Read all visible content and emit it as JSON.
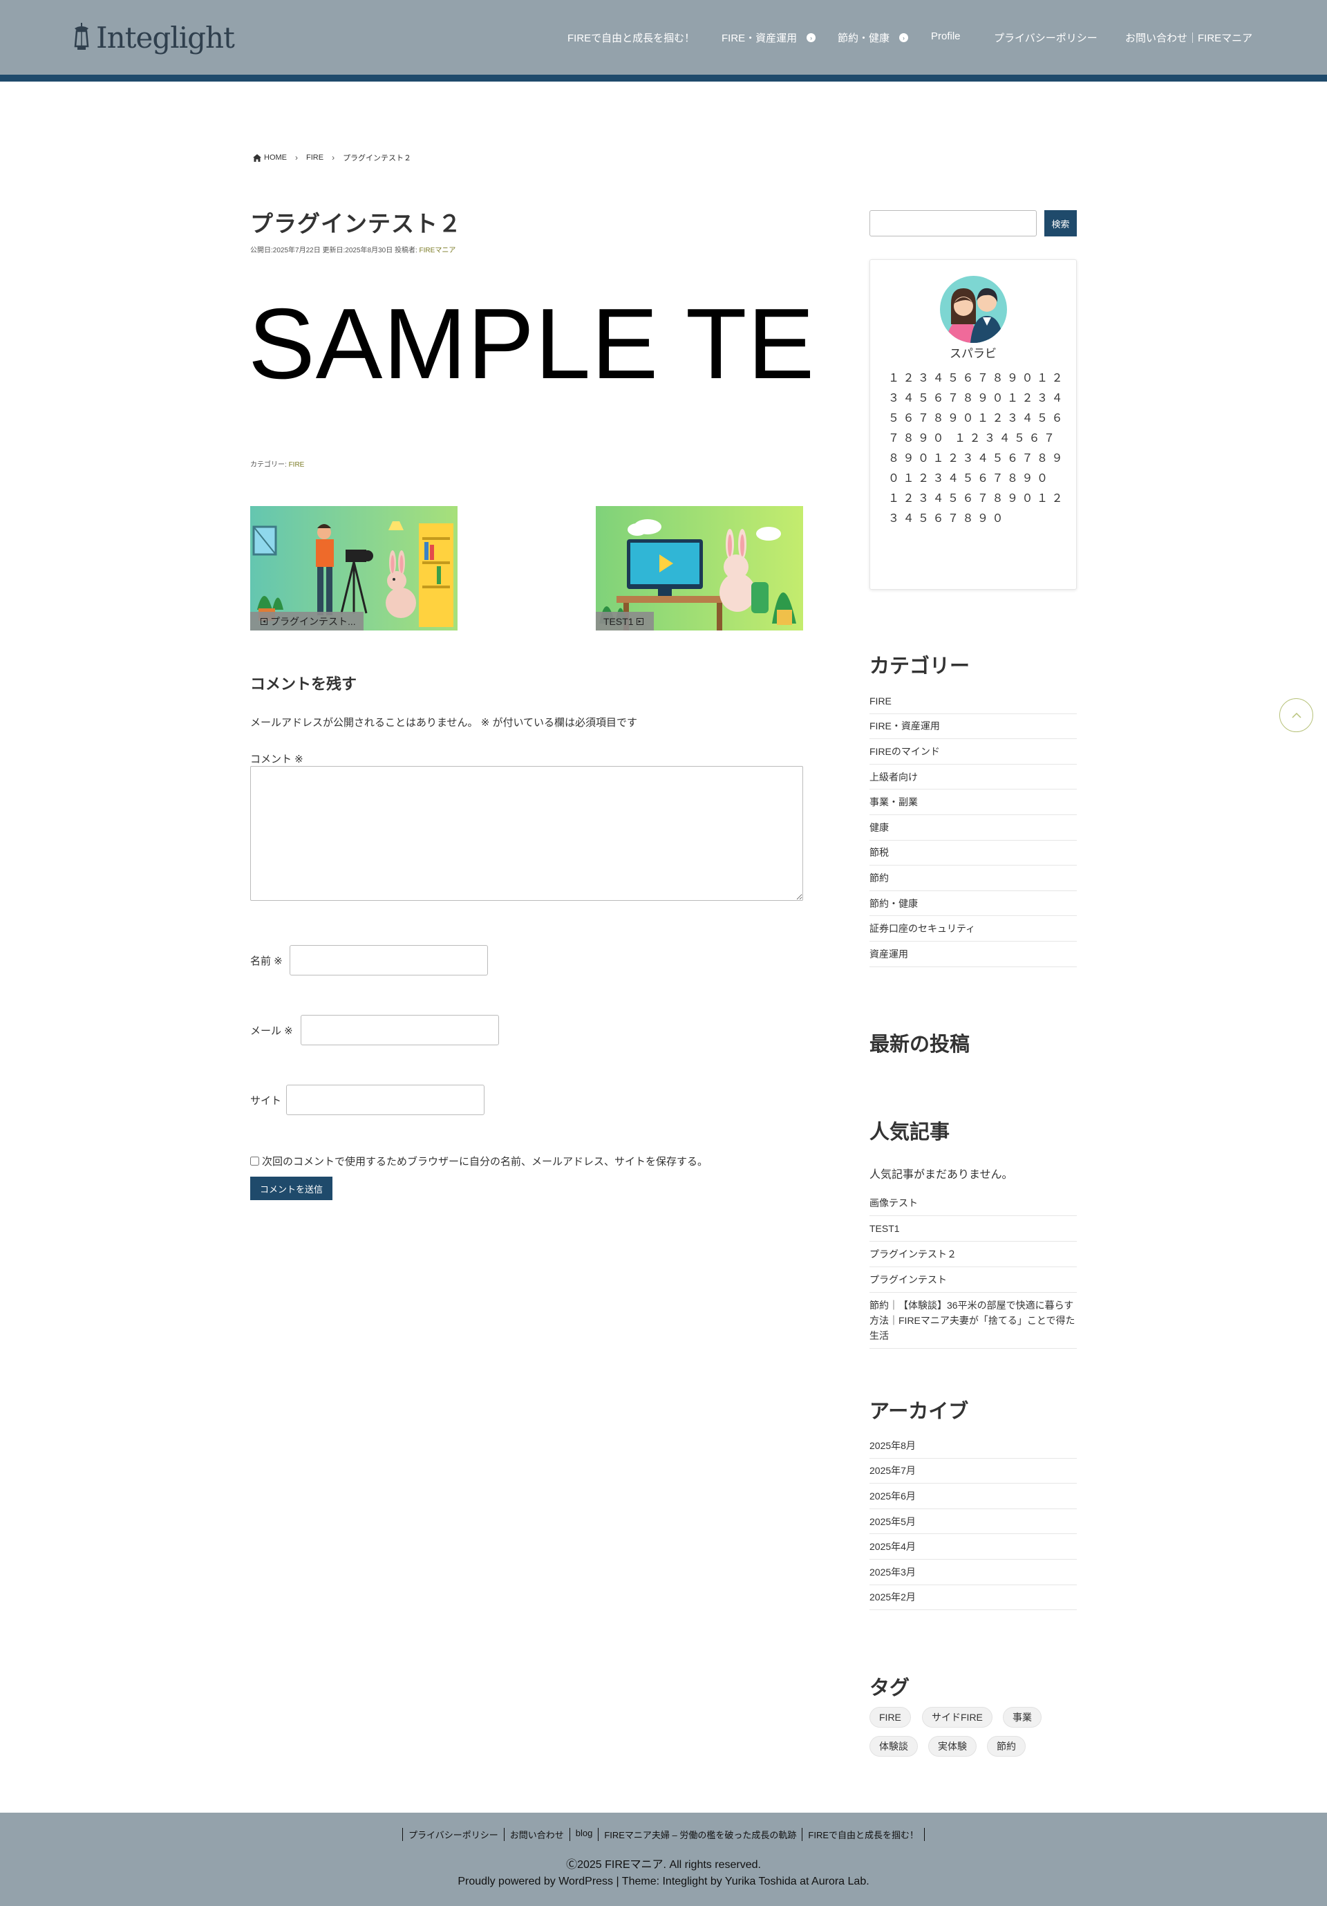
{
  "site": {
    "logo_text": "Integlight"
  },
  "nav": {
    "items": [
      {
        "label": "FIREで自由と成長を掴む！"
      },
      {
        "label": "FIRE・資産運用"
      },
      {
        "label": "節約・健康"
      },
      {
        "label": "Profile"
      },
      {
        "label": "プライバシーポリシー"
      },
      {
        "label": "お問い合わせ｜FIREマニア"
      }
    ]
  },
  "breadcrumb": {
    "home": "HOME",
    "category": "FIRE",
    "current": "プラグインテスト２"
  },
  "post": {
    "title": "プラグインテスト２",
    "meta_text": "公開日:2025年7月22日 更新日:2025年8月30日 投稿者:",
    "author": "FIREマニア",
    "sample_text": "SAMPLE TE",
    "category_prefix": "カテゴリー:",
    "category": "FIRE"
  },
  "related": [
    {
      "label": "プラグインテスト..."
    },
    {
      "label": "TEST1"
    }
  ],
  "comment_form": {
    "heading": "コメントを残す",
    "notes": "メールアドレスが公開されることはありません。 ※ が付いている欄は必須項目です",
    "comment_label": "コメント ※",
    "name_label": "名前 ※",
    "email_label": "メール ※",
    "site_label": "サイト",
    "cookie_text": "次回のコメントで使用するためブラウザーに自分の名前、メールアドレス、サイトを保存する。",
    "submit_label": "コメントを送信"
  },
  "sidebar": {
    "search_button": "検索",
    "profile": {
      "name": "スパラビ",
      "bio": "１２３４５６７８９０１２３４５６７８９０１２３４５６７８９０１２３４５６７８９０ １２３４５６７８９０１２３４５６７８９０１２３４５６７８９０ １２３４５６７８９０１２３４５６７８９０"
    },
    "categories_heading": "カテゴリー",
    "categories": [
      "FIRE",
      "FIRE・資産運用",
      "FIREのマインド",
      "上級者向け",
      "事業・副業",
      "健康",
      "節税",
      "節約",
      "節約・健康",
      "証券口座のセキュリティ",
      "資産運用"
    ],
    "recent_heading": "最新の投稿",
    "popular_heading": "人気記事",
    "popular_empty": "人気記事がまだありません。",
    "popular_posts": [
      "画像テスト",
      "TEST1",
      "プラグインテスト２",
      "プラグインテスト",
      "節約｜【体験談】36平米の部屋で快適に暮らす方法｜FIREマニア夫妻が「捨てる」ことで得た生活"
    ],
    "archives_heading": "アーカイブ",
    "archives": [
      "2025年8月",
      "2025年7月",
      "2025年6月",
      "2025年5月",
      "2025年4月",
      "2025年3月",
      "2025年2月"
    ],
    "tags_heading": "タグ",
    "tags": [
      "FIRE",
      "サイドFIRE",
      "事業",
      "体験談",
      "実体験",
      "節約"
    ]
  },
  "footer": {
    "links": [
      "プライバシーポリシー",
      "お問い合わせ",
      "blog",
      "FIREマニア夫婦 – 労働の檻を破った成長の軌跡",
      "FIREで自由と成長を掴む！"
    ],
    "copyright": "Ⓒ2025 FIREマニア. All rights reserved.",
    "powered": "Proudly powered by WordPress | Theme: Integlight by Yurika Toshida at Aurora Lab."
  },
  "colors": {
    "header_bg": "#94a2ab",
    "accent": "#1f4a6b",
    "author_link": "#7a7a24"
  }
}
